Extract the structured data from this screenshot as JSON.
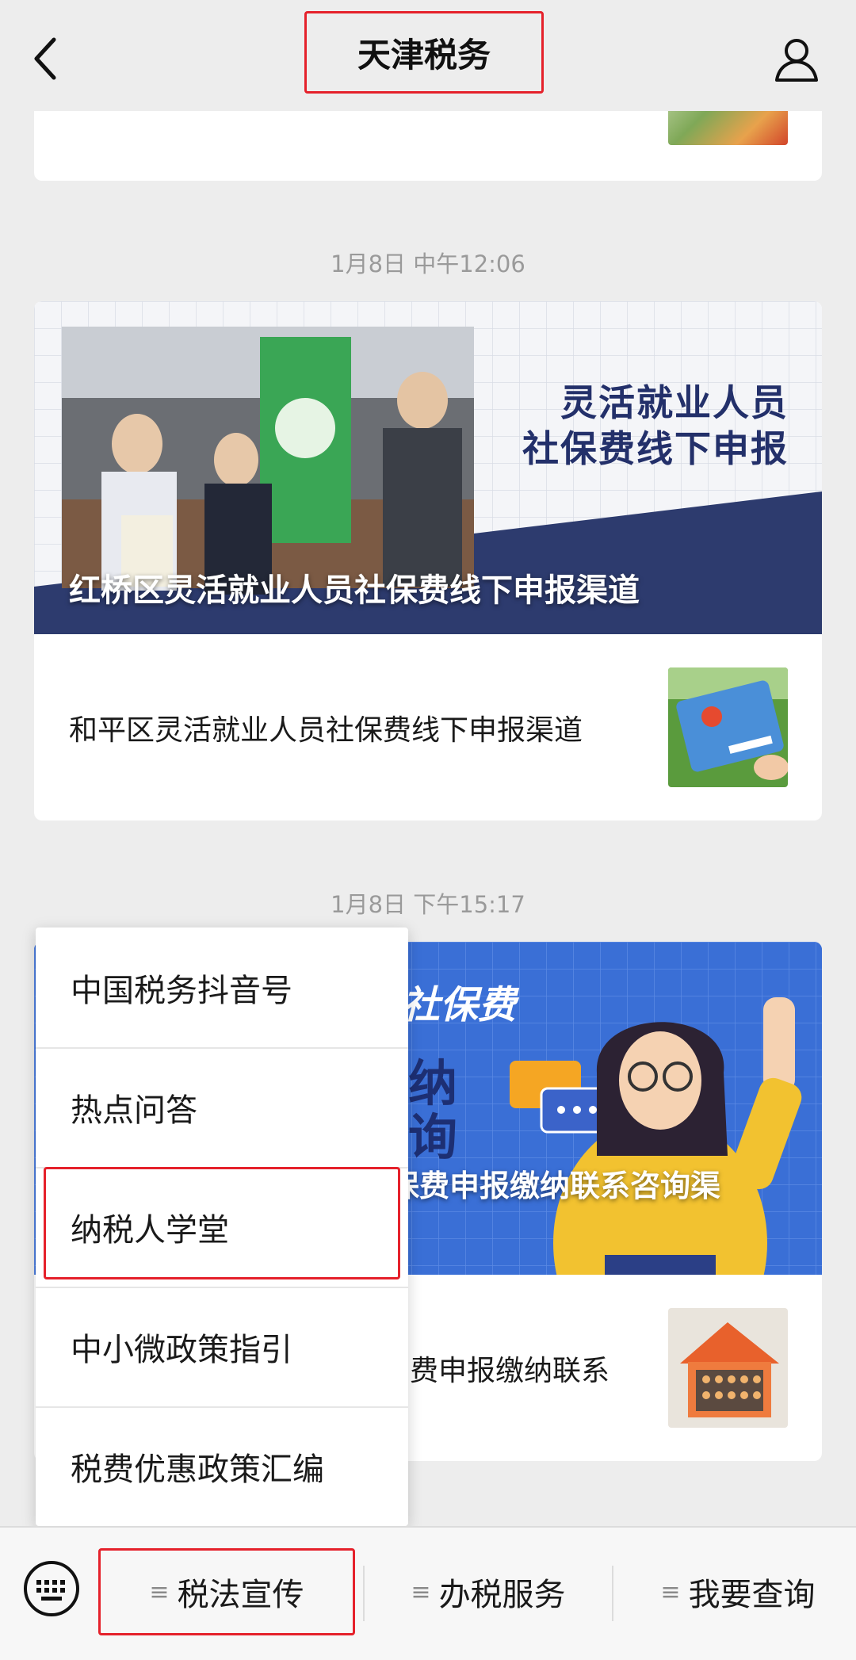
{
  "header": {
    "title": "天津税务"
  },
  "messages": [
    {
      "timestamp": "1月8日 中午12:06",
      "hero_caption": "红桥区灵活就业人员社保费线下申报渠道",
      "hero_banner_line1": "灵活就业人员",
      "hero_banner_line2": "社保费线下申报",
      "item": "和平区灵活就业人员社保费线下申报渠道"
    },
    {
      "timestamp": "1月8日 下午15:17",
      "hero_caption": "保费申报缴纳联系咨询渠",
      "hero_banner_text": "社保费",
      "hero_side1": "纳",
      "hero_side2": "询",
      "item": "费申报缴纳联系"
    }
  ],
  "popup_menu": {
    "items": [
      "中国税务抖音号",
      "热点问答",
      "纳税人学堂",
      "中小微政策指引",
      "税费优惠政策汇编"
    ],
    "highlighted_index": 2
  },
  "bottom_menu": {
    "tabs": [
      "税法宣传",
      "办税服务",
      "我要查询"
    ],
    "active_index": 0
  },
  "colors": {
    "highlight": "#e5212b",
    "background": "#ededed"
  }
}
